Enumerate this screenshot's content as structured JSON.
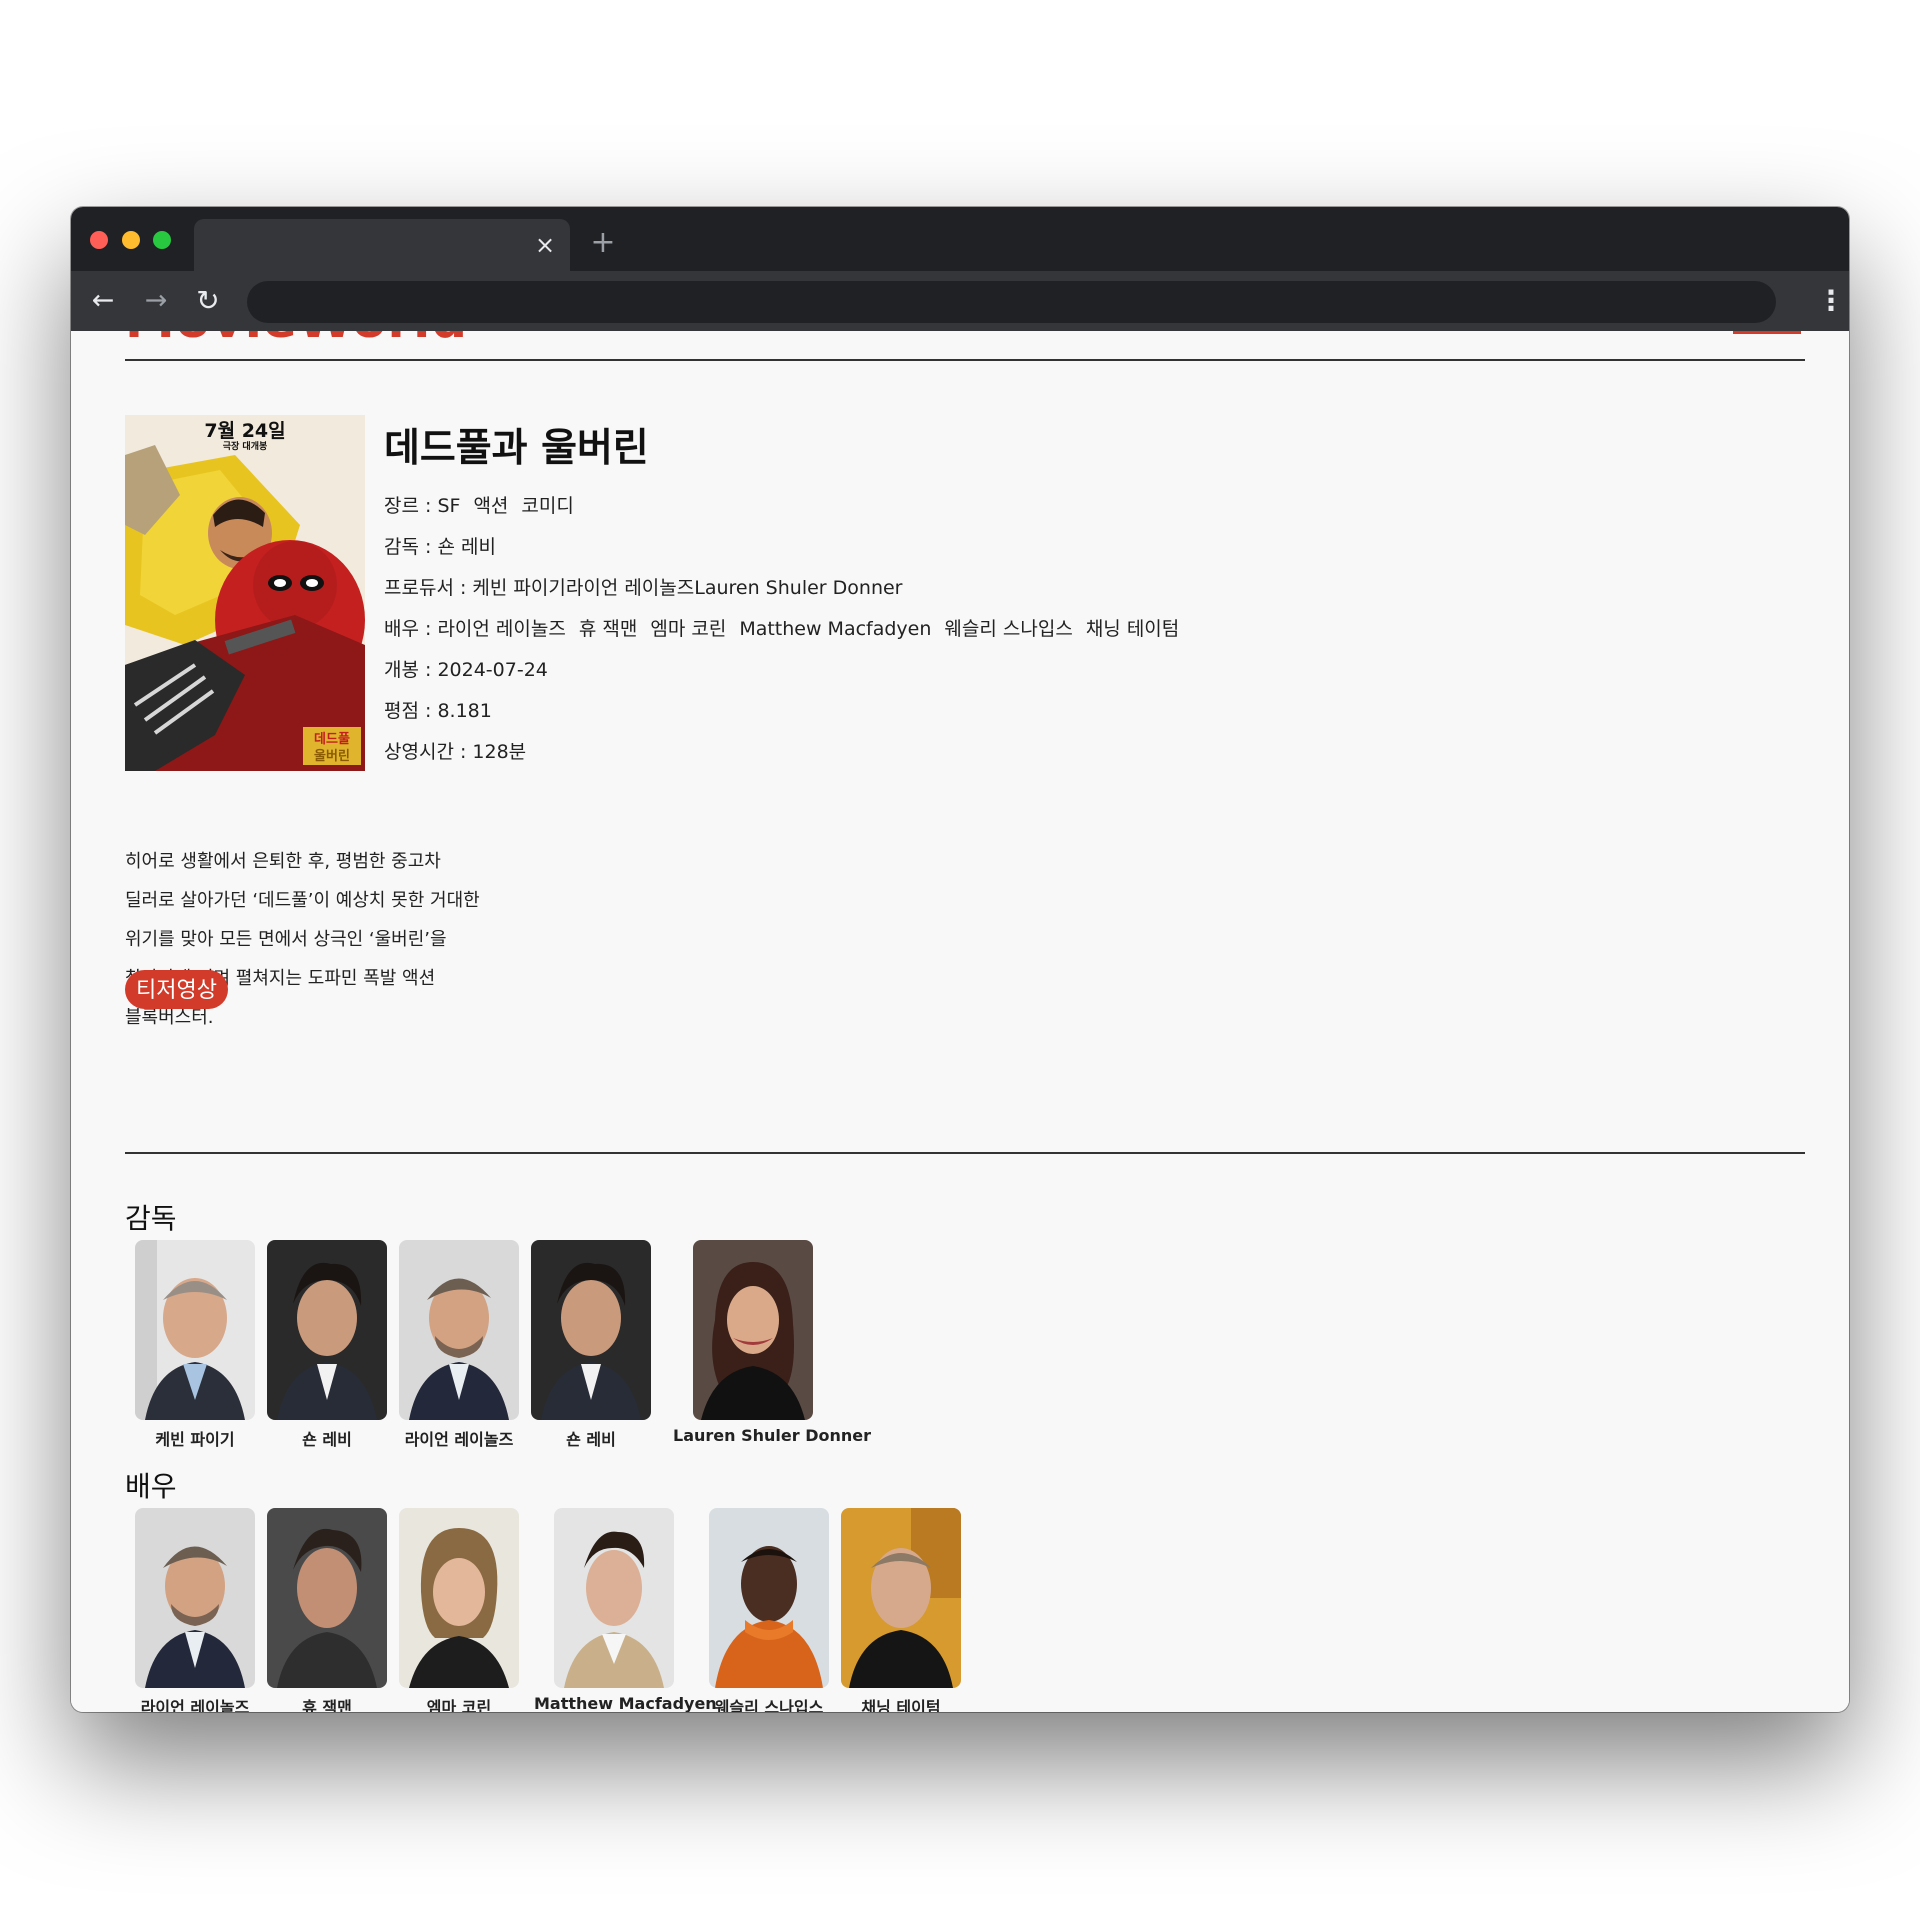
{
  "browser": {
    "tab_close": "×",
    "new_tab": "+",
    "back": "←",
    "forward": "→",
    "reload": "↻",
    "menu": "⋮"
  },
  "header": {
    "logo": "MovieWorld"
  },
  "movie": {
    "title": "데드풀과 울버린",
    "poster_text": {
      "date_line": "7월 24일",
      "sub_line": "극장 대개봉",
      "logo_line1": "데드풀",
      "logo_line2": "울버린"
    },
    "genre_label": "장르 : ",
    "genres": [
      "SF",
      "액션",
      "코미디"
    ],
    "director_label": "감독 : ",
    "director": "숀 레비",
    "producer_label": "프로듀서 : ",
    "producers": "케빈 파이기라이언 레이놀즈Lauren Shuler Donner",
    "cast_label": "배우 : ",
    "cast": [
      "라이언 레이놀즈",
      "휴 잭맨",
      "엠마 코린",
      "Matthew Macfadyen",
      "웨슬리 스나입스",
      "채닝 테이텀"
    ],
    "release_label": "개봉 : ",
    "release": "2024-07-24",
    "rating_label": "평점 : ",
    "rating": "8.181",
    "runtime_label": "상영시간 : ",
    "runtime": "128분",
    "overview": [
      "히어로 생활에서 은퇴한 후, 평범한 중고차",
      "딜러로 살아가던 ‘데드풀’이 예상치 못한 거대한",
      "위기를 맞아 모든 면에서 상극인 ‘울버린’을",
      "찾아가게 되며 펼쳐지는 도파민 폭발 액션",
      "블록버스터."
    ],
    "teaser_button": "티저영상"
  },
  "crew_section": {
    "title": "감독",
    "people": [
      "케빈 파이기",
      "숀 레비",
      "라이언 레이놀즈",
      "숀 레비",
      "Lauren Shuler Donner"
    ]
  },
  "cast_section": {
    "title": "배우",
    "people": [
      "라이언 레이놀즈",
      "휴 잭맨",
      "엠마 코린",
      "Matthew Macfadyen",
      "웨슬리 스나입스",
      "채닝 테이텀"
    ]
  }
}
